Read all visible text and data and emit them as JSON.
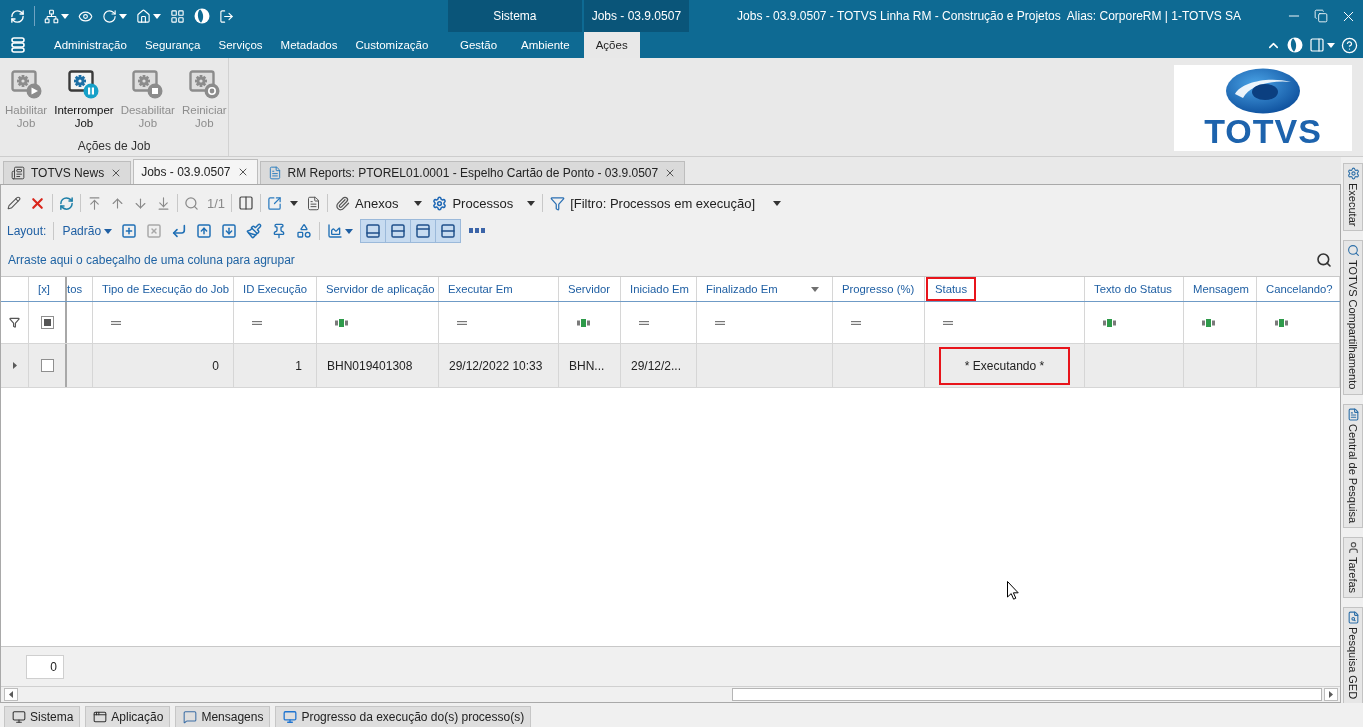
{
  "title_bar": {
    "context_groups": [
      {
        "label": "Sistema",
        "tabs": [
          {
            "label": "Gestão",
            "selected": false
          },
          {
            "label": "Ambiente",
            "selected": false
          }
        ]
      },
      {
        "label": "Jobs - 03.9.0507",
        "tabs": [
          {
            "label": "Ações",
            "selected": true
          }
        ]
      }
    ],
    "title": "Jobs - 03.9.0507 - TOTVS Linha RM - Construção e Projetos  Alias: CorporeRM | 1-TOTVS SA"
  },
  "menu": [
    {
      "label": "Administração",
      "selected": false
    },
    {
      "label": "Segurança",
      "selected": false
    },
    {
      "label": "Serviços",
      "selected": false
    },
    {
      "label": "Metadados",
      "selected": false
    },
    {
      "label": "Customização",
      "selected": false
    }
  ],
  "ribbon": {
    "group": "Ações de Job",
    "buttons": [
      {
        "label": "Habilitar Job",
        "disabled": true
      },
      {
        "label": "Interromper Job",
        "disabled": false
      },
      {
        "label": "Desabilitar Job",
        "disabled": true
      },
      {
        "label": "Reiniciar Job",
        "disabled": true
      }
    ],
    "logo": "TOTVS"
  },
  "document_tabs": [
    {
      "label": "TOTVS News",
      "selected": false
    },
    {
      "label": "Jobs - 03.9.0507",
      "selected": true
    },
    {
      "label": "RM Reports: PTOREL01.0001 - Espelho Cartão de Ponto - 03.9.0507",
      "selected": false
    }
  ],
  "toolbar": {
    "page": "1/1",
    "attachments": "Anexos",
    "processes": "Processos",
    "filter": "[Filtro: Processos em execução]"
  },
  "layout_bar": {
    "label": "Layout:",
    "layout": "Padrão",
    "view_toggles": [
      {
        "selected": true
      },
      {
        "selected": true
      },
      {
        "selected": true
      },
      {
        "selected": true
      }
    ]
  },
  "group_panel": "Arraste aqui o cabeçalho de uma coluna para agrupar",
  "grid": {
    "columns": [
      {
        "label": "[x]",
        "kind": "check",
        "highlighted": false,
        "filter_button": false
      },
      {
        "label": "tos",
        "kind": "cut",
        "highlighted": false,
        "filter_button": false
      },
      {
        "label": "Tipo de Execução do Job",
        "kind": "number",
        "highlighted": false,
        "filter_button": false
      },
      {
        "label": "ID Execução",
        "kind": "number",
        "highlighted": false,
        "filter_button": false
      },
      {
        "label": "Servidor de aplicação",
        "kind": "text",
        "highlighted": false,
        "filter_button": false
      },
      {
        "label": "Executar Em",
        "kind": "date",
        "highlighted": false,
        "filter_button": false
      },
      {
        "label": "Servidor",
        "kind": "text",
        "highlighted": false,
        "filter_button": false
      },
      {
        "label": "Iniciado Em",
        "kind": "date",
        "highlighted": false,
        "filter_button": false
      },
      {
        "label": "Finalizado Em",
        "kind": "date",
        "highlighted": false,
        "filter_button": true
      },
      {
        "label": "Progresso (%)",
        "kind": "number",
        "highlighted": false,
        "filter_button": false
      },
      {
        "label": "Status",
        "kind": "status",
        "highlighted": true,
        "filter_button": false
      },
      {
        "label": "Texto do Status",
        "kind": "text",
        "highlighted": false,
        "filter_button": false
      },
      {
        "label": "Mensagem",
        "kind": "text",
        "highlighted": false,
        "filter_button": false
      },
      {
        "label": "Cancelando?",
        "kind": "text",
        "highlighted": false,
        "filter_button": false
      }
    ],
    "select_all": {
      "mixed": true
    },
    "rows": [
      {
        "selected": true,
        "checked": false,
        "cells": [
          null,
          null,
          "0",
          "1",
          "BHN019401308",
          "29/12/2022 10:33",
          "BHN...",
          "29/12/2...",
          null,
          null,
          "* Executando *",
          null,
          null,
          null
        ]
      }
    ]
  },
  "footer": {
    "count": "0"
  },
  "status_tabs": [
    "Sistema",
    "Aplicação",
    "Mensagens",
    "Progresso da execução do(s) processo(s)"
  ],
  "side_tabs": [
    "Executar",
    "TOTVS Compartilhamento",
    "Central de Pesquisa",
    "Tarefas",
    "Pesquisa GED"
  ]
}
